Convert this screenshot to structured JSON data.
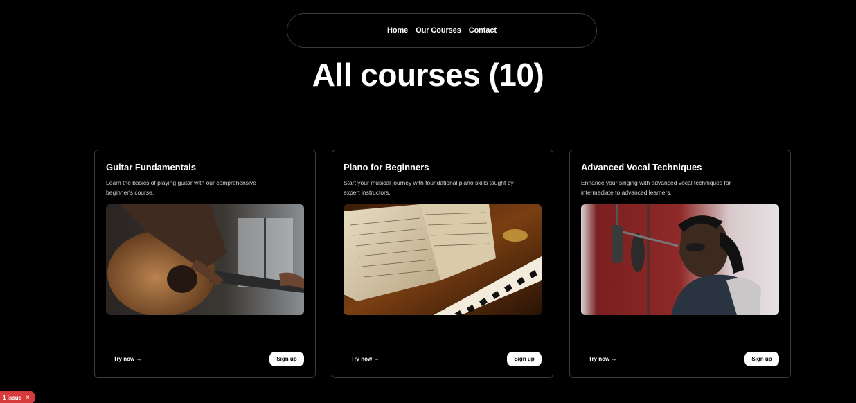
{
  "nav": {
    "links": [
      "Home",
      "Our Courses",
      "Contact"
    ]
  },
  "header": {
    "title": "All courses (10)"
  },
  "courses": [
    {
      "title": "Guitar Fundamentals",
      "description": "Learn the basics of playing guitar with our comprehensive beginner's course.",
      "image": "guitar-photo",
      "try_label": "Try now →",
      "signup_label": "Sign up"
    },
    {
      "title": "Piano for Beginners",
      "description": "Start your musical journey with foundational piano skills taught by expert instructors.",
      "image": "piano-photo",
      "try_label": "Try now →",
      "signup_label": "Sign up"
    },
    {
      "title": "Advanced Vocal Techniques",
      "description": "Enhance your singing with advanced vocal techniques for intermediate to advanced learners.",
      "image": "vocal-studio-photo",
      "try_label": "Try now →",
      "signup_label": "Sign up"
    }
  ],
  "devtools": {
    "issue_label": "1 issue",
    "close_icon": "×"
  },
  "colors": {
    "background": "#000000",
    "border": "#3a3a3a",
    "badge": "#d63b3b"
  }
}
